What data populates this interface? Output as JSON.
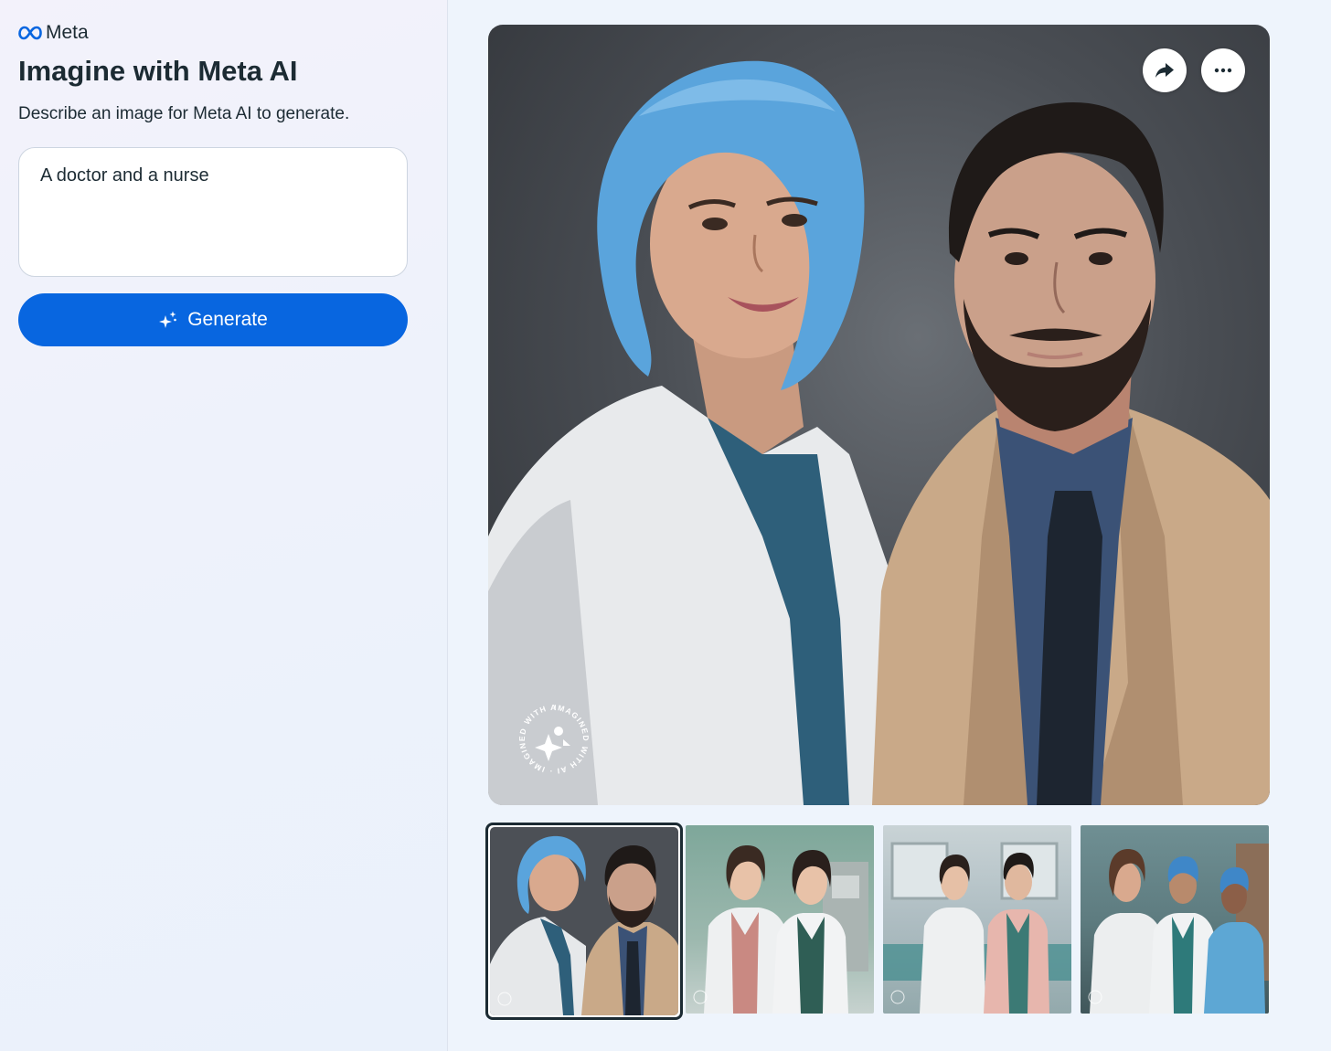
{
  "brand": {
    "name": "Meta",
    "logo_icon": "meta-infinity-icon",
    "logo_color": "#0866e0"
  },
  "header": {
    "title": "Imagine with Meta AI",
    "subtitle": "Describe an image for Meta AI to generate."
  },
  "prompt": {
    "value": "A doctor and a nurse"
  },
  "generate_button": {
    "label": "Generate",
    "icon": "sparkle-icon",
    "color": "#0866e0"
  },
  "main_image": {
    "actions": [
      {
        "name": "share",
        "icon": "share-arrow-icon"
      },
      {
        "name": "more",
        "icon": "more-dots-icon"
      }
    ],
    "watermark_text": "IMAGINED WITH AI · IMAGINED WITH AI ·"
  },
  "thumbnails": {
    "count": 4,
    "selected_index": 0
  }
}
